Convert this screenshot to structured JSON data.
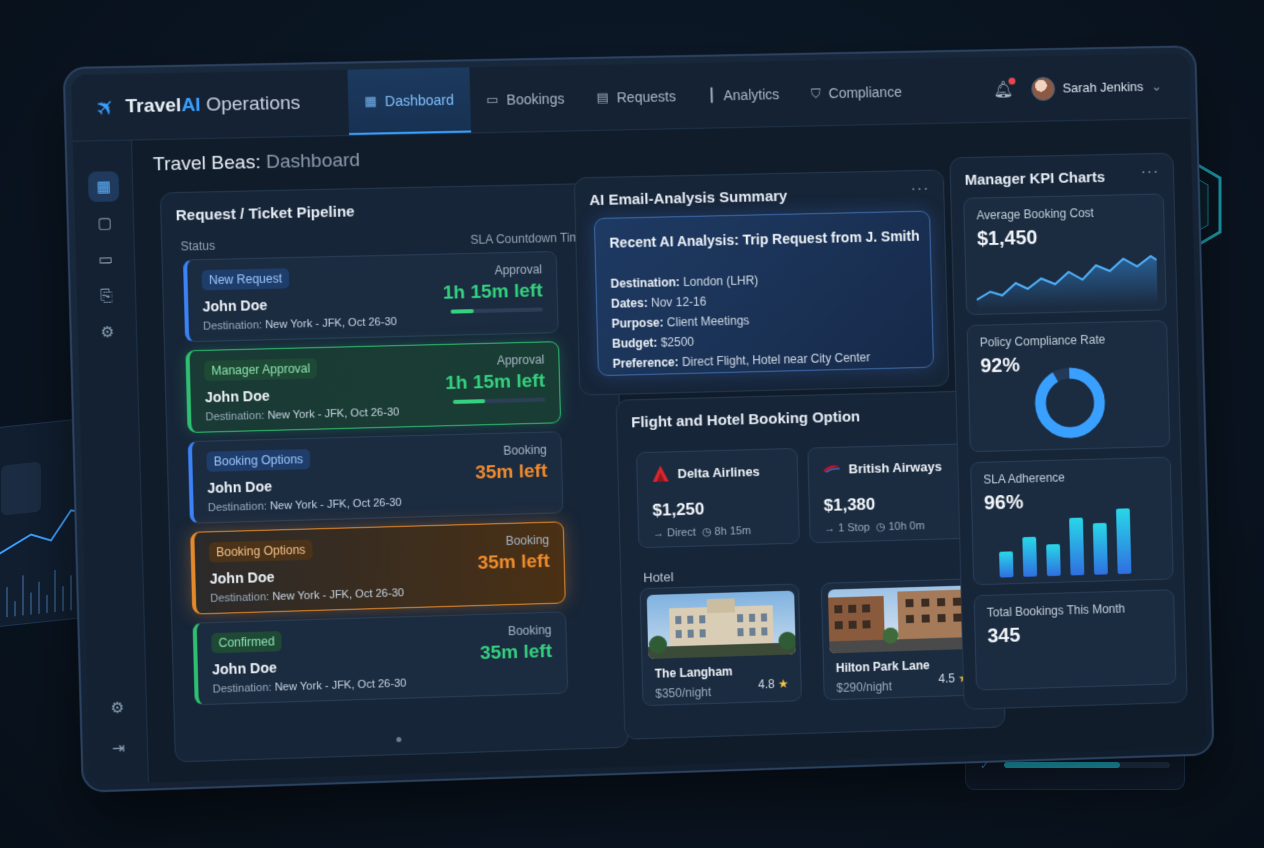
{
  "app": {
    "brand_prefix": "Travel",
    "brand_ai": "AI",
    "brand_suffix": "Operations"
  },
  "nav": [
    {
      "label": "Dashboard",
      "icon": "grid-icon",
      "active": true
    },
    {
      "label": "Bookings",
      "icon": "calendar-icon",
      "active": false
    },
    {
      "label": "Requests",
      "icon": "document-icon",
      "active": false
    },
    {
      "label": "Analytics",
      "icon": "bar-chart-icon",
      "active": false
    },
    {
      "label": "Compliance",
      "icon": "shield-icon",
      "active": false
    }
  ],
  "user": {
    "name": "Sarah Jenkins"
  },
  "page": {
    "title_main": "Travel Beas:",
    "title_sub": "Dashboard"
  },
  "pipeline": {
    "title": "Request / Ticket Pipeline",
    "col_status": "Status",
    "col_sla": "SLA Countdown Timers",
    "tickets": [
      {
        "status": "New Request",
        "name": "John Doe",
        "dest_label": "Destination:",
        "dest": "New York - JFK, Oct 26-30",
        "stage": "Approval",
        "time": "1h 15m left",
        "progress": 0.25
      },
      {
        "status": "Manager Approval",
        "name": "John Doe",
        "dest_label": "Destination:",
        "dest": "New York - JFK,  Oct 26-30",
        "stage": "Approval",
        "time": "1h 15m left",
        "progress": 0.35
      },
      {
        "status": "Booking Options",
        "name": "John Doe",
        "dest_label": "Destination:",
        "dest": "New York - JFK, Oct 26-30",
        "stage": "Booking",
        "time": "35m left"
      },
      {
        "status": "Booking Options",
        "name": "John Doe",
        "dest_label": "Destination:",
        "dest": "New York - JFK,  Oct 26-30",
        "stage": "Booking",
        "time": "35m left"
      },
      {
        "status": "Confirmed",
        "name": "John Doe",
        "dest_label": "Destination:",
        "dest": "New York - JFK,  Oct 26-30",
        "stage": "Booking",
        "time": "35m left"
      }
    ]
  },
  "email": {
    "title": "AI Email-Analysis Summary",
    "card_title": "Recent AI Analysis: Trip Request from J. Smith",
    "rows": [
      {
        "label": "Destination:",
        "value": "London (LHR)"
      },
      {
        "label": "Dates:",
        "value": "Nov 12-16"
      },
      {
        "label": "Purpose:",
        "value": "Client Meetings"
      },
      {
        "label": "Budget:",
        "value": "$2500"
      },
      {
        "label": "Preference:",
        "value": "Direct Flight, Hotel near City Center"
      }
    ]
  },
  "booking": {
    "title": "Flight and Hotel Booking Option",
    "flights": [
      {
        "airline": "Delta Airlines",
        "price": "$1,250",
        "stops": "Direct",
        "duration": "8h 15m",
        "logo_color": "#d9262e"
      },
      {
        "airline": "British Airways",
        "price": "$1,380",
        "stops": "1 Stop",
        "duration": "10h 0m",
        "logo_color": "#c8102e"
      }
    ],
    "hotel_label": "Hotel",
    "hotels": [
      {
        "name": "The Langham",
        "price": "$350",
        "unit": "/night",
        "rating": "4.8"
      },
      {
        "name": "Hilton Park Lane",
        "price": "$290",
        "unit": "/night",
        "rating": "4.5"
      }
    ]
  },
  "kpi": {
    "title": "Manager KPI Charts",
    "avg_cost_label": "Average Booking Cost",
    "avg_cost_value": "$1,450",
    "compliance_label": "Policy Compliance Rate",
    "compliance_value": "92%",
    "compliance_fraction": 0.92,
    "sla_label": "SLA Adherence",
    "sla_value": "96%",
    "total_label": "Total Bookings This Month",
    "total_value": "345"
  },
  "colors": {
    "accent": "#3aa0ff",
    "success": "#34d17f",
    "warning": "#f08b2c"
  }
}
